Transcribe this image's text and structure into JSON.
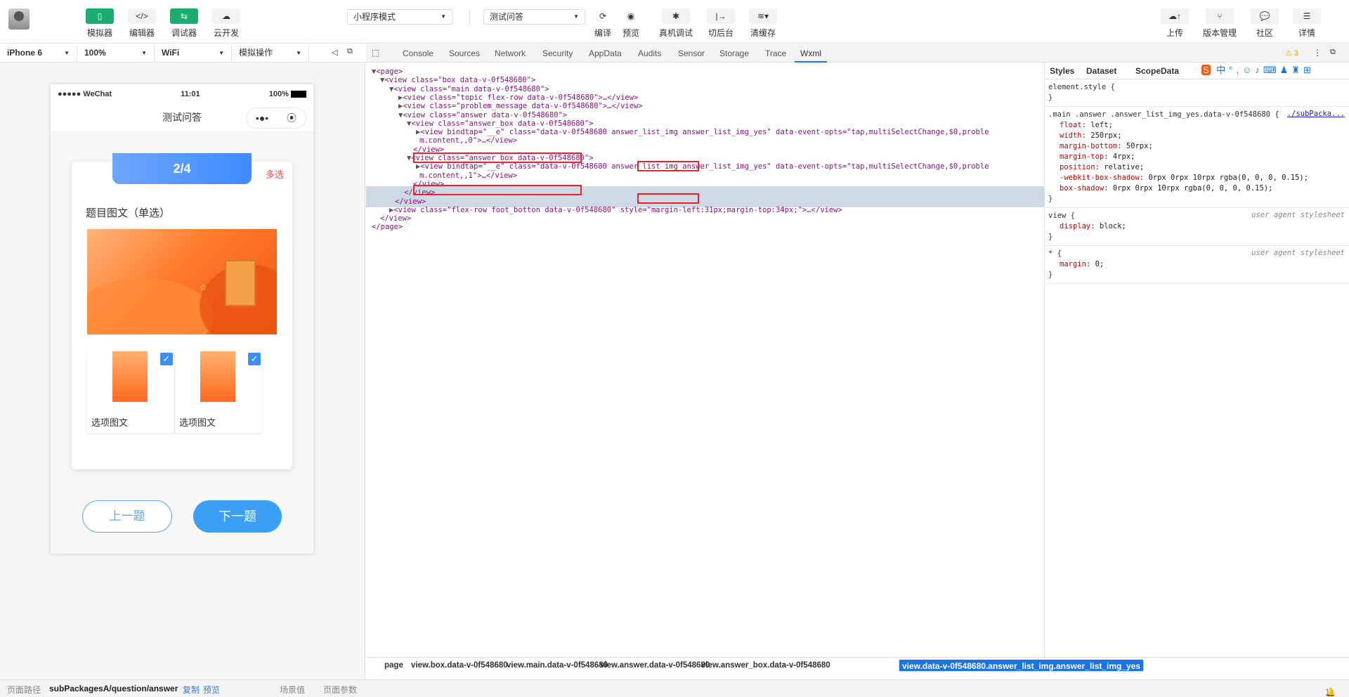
{
  "toolbar": {
    "left_buttons": [
      "模拟器",
      "编辑器",
      "调试器",
      "云开发"
    ],
    "mode_select": "小程序模式",
    "compile_select": "测试问答",
    "mid_buttons": [
      "编译",
      "预览",
      "真机调试",
      "切后台",
      "清缓存"
    ],
    "right_buttons": [
      "上传",
      "版本管理",
      "社区",
      "详情"
    ],
    "colors": {
      "green": "#1aad6f",
      "accent": "#1a73e8"
    }
  },
  "simulator": {
    "device": "iPhone 6",
    "zoom": "100%",
    "network": "WiFi",
    "operation": "模拟操作",
    "status_left": "●●●●● WeChat",
    "time": "11:01",
    "battery": "100%",
    "nav_title": "测试问答",
    "progress": "2/4",
    "multi_label": "多选",
    "question_title": "题目图文（单选）",
    "options": [
      "选项图文",
      "选项图文"
    ],
    "prev_button": "上一题",
    "next_button": "下一题"
  },
  "devtools": {
    "tabs": [
      "Console",
      "Sources",
      "Network",
      "Security",
      "AppData",
      "Audits",
      "Sensor",
      "Storage",
      "Trace",
      "Wxml"
    ],
    "active_tab": "Wxml",
    "warning_count": "3",
    "tree_lines": [
      {
        "tri": "▼",
        "text": "<page>"
      },
      {
        "tri": "▼",
        "text": "<view class=\"box data-v-0f548680\">"
      },
      {
        "tri": "▼",
        "text": "<view class=\"main data-v-0f548680\">"
      },
      {
        "tri": "▶",
        "text": "<view class=\"topic flex-row data-v-0f548680\">…</view>"
      },
      {
        "tri": "▶",
        "text": "<view class=\"problem_message data-v-0f548680\">…</view>"
      },
      {
        "tri": "▼",
        "text": "<view class=\"answer data-v-0f548680\">"
      },
      {
        "tri": "▼",
        "text": "<view class=\"answer_box data-v-0f548680\">"
      },
      {
        "tri": "▶",
        "text": "<view bindtap=\"__e\" class=\"data-v-0f548680 answer_list_img answer_list_img_yes\" data-event-opts=\"tap,multiSelectChange,$0,proble"
      },
      {
        "tri": "",
        "text": "m.content,,0\">…</view>"
      },
      {
        "tri": "",
        "text": "</view>"
      },
      {
        "tri": "▼",
        "text": "<view class=\"answer_box data-v-0f548680\">"
      },
      {
        "tri": "▶",
        "text": "<view bindtap=\"__e\" class=\"data-v-0f548680 answer_list_img answer_list_img_yes\" data-event-opts=\"tap,multiSelectChange,$0,proble"
      },
      {
        "tri": "",
        "text": "m.content,,1\">…</view>"
      },
      {
        "tri": "",
        "text": "</view>"
      },
      {
        "tri": "",
        "text": "</view>"
      },
      {
        "tri": "",
        "text": "</view>"
      },
      {
        "tri": "▶",
        "text": "<view class=\"flex-row foot_botton data-v-0f548680\" style=\"margin-left:31px;margin-top:34px;\">…</view>"
      },
      {
        "tri": "",
        "text": "</view>"
      },
      {
        "tri": "",
        "text": "</page>"
      }
    ],
    "styles_tabs": [
      "Styles",
      "Dataset",
      "ScopeData"
    ],
    "rules": [
      {
        "selector": "element.style {",
        "props": [],
        "source": ""
      },
      {
        "selector": ".main .answer .answer_list_img_yes.data-v-0f548680 {",
        "source": "./subPacka...",
        "props": [
          [
            "float",
            "left;"
          ],
          [
            "width",
            "250rpx;"
          ],
          [
            "margin-bottom",
            "50rpx;"
          ],
          [
            "margin-top",
            "4rpx;"
          ],
          [
            "position",
            "relative;"
          ],
          [
            "-webkit-box-shadow",
            "0rpx 0rpx 10rpx rgba(0, 0, 0, 0.15);"
          ],
          [
            "box-shadow",
            "0rpx 0rpx 10rpx rgba(0, 0, 0, 0.15);"
          ]
        ]
      },
      {
        "selector": "view {",
        "source": "user agent stylesheet",
        "props": [
          [
            "display",
            "block;"
          ]
        ]
      },
      {
        "selector": "* {",
        "source": "user agent stylesheet",
        "props": [
          [
            "margin",
            "0;"
          ]
        ]
      }
    ],
    "breadcrumbs": [
      "page",
      "view.box.data-v-0f548680",
      "view.main.data-v-0f548680",
      "view.answer.data-v-0f548680",
      "view.answer_box.data-v-0f548680",
      "view.data-v-0f548680.answer_list_img.answer_list_img_yes"
    ]
  },
  "bottom_bar": {
    "path_label": "页面路径",
    "path": "subPackagesA/question/answer",
    "copy": "复制",
    "preview": "预览",
    "scene": "场景值",
    "params": "页面参数",
    "alerts": "1"
  }
}
